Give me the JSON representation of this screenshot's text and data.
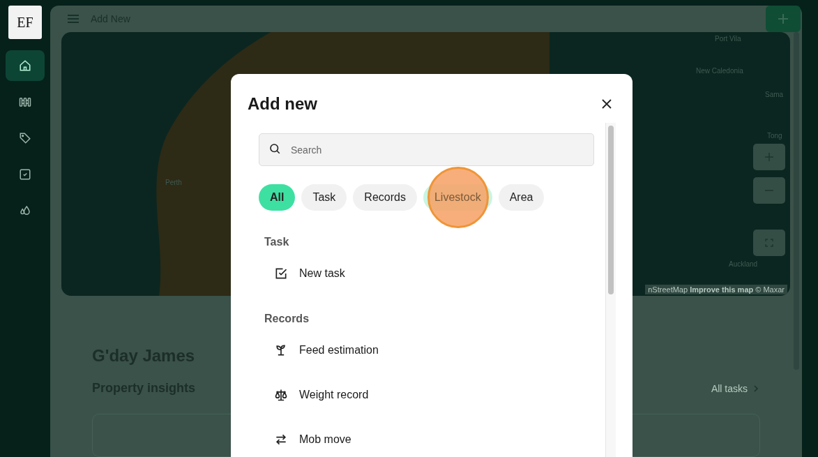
{
  "sidebar": {
    "logo": "EF",
    "items": [
      {
        "kind": "home",
        "selected": true
      },
      {
        "kind": "fence",
        "selected": false
      },
      {
        "kind": "tag",
        "selected": false
      },
      {
        "kind": "check",
        "selected": false
      },
      {
        "kind": "drops",
        "selected": false
      }
    ]
  },
  "header": {
    "title": "Add New"
  },
  "map": {
    "labels": [
      "Perth",
      "Port Vila",
      "New Caledonia",
      "Sama",
      "Tong",
      "Auckland"
    ],
    "attribution": "nStreetMap **Improve this map** © Maxar"
  },
  "dashboard": {
    "greeting": "G'day James",
    "subtitle": "Property insights",
    "link": "All tasks"
  },
  "modal": {
    "title": "Add new",
    "search": {
      "placeholder": "Search"
    },
    "filters": [
      {
        "label": "All",
        "selected": true,
        "hovered": false
      },
      {
        "label": "Task",
        "selected": false,
        "hovered": false
      },
      {
        "label": "Records",
        "selected": false,
        "hovered": false
      },
      {
        "label": "Livestock",
        "selected": false,
        "hovered": true
      },
      {
        "label": "Area",
        "selected": false,
        "hovered": false
      }
    ],
    "sections": [
      {
        "title": "Task",
        "items": [
          {
            "kind": "task",
            "label": "New task"
          }
        ]
      },
      {
        "title": "Records",
        "items": [
          {
            "kind": "feed",
            "label": "Feed estimation"
          },
          {
            "kind": "weight",
            "label": "Weight record"
          },
          {
            "kind": "move",
            "label": "Mob move"
          }
        ]
      }
    ]
  }
}
